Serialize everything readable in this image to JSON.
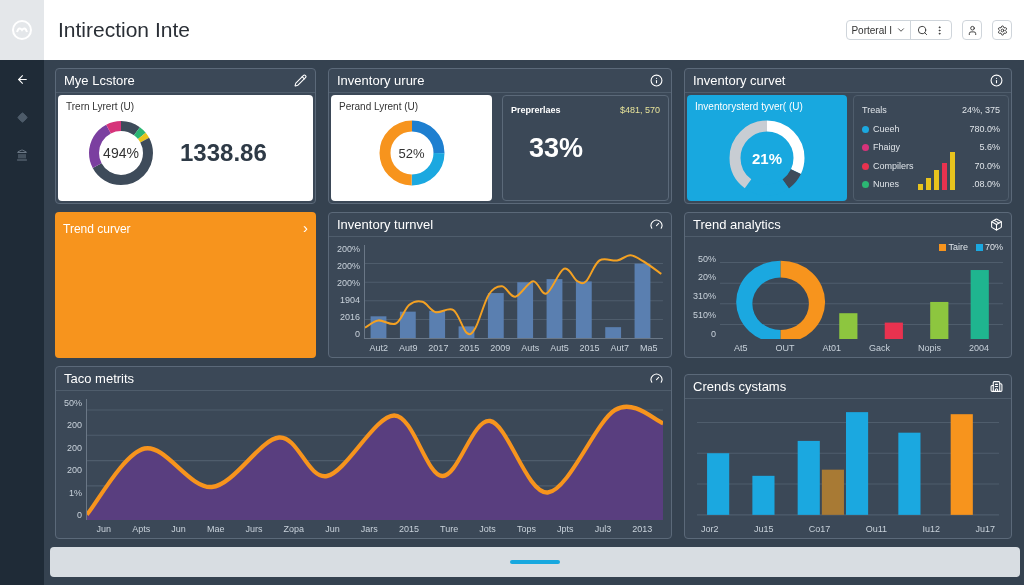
{
  "header": {
    "title": "Intirection Inte",
    "selector": {
      "value": "Porteral I"
    }
  },
  "store_panel": {
    "title": "Mye Lcstore",
    "card": {
      "label": "Trern Lyrert (U)",
      "donut_value": "494%",
      "big_value": "1338.86"
    }
  },
  "inventory_panel": {
    "title": "Inventory urure",
    "white_card": {
      "label": "Perand Lyrent (U)",
      "donut_value": "52%"
    },
    "dark_card": {
      "label": "Preprerlaes",
      "amount": "$481, 570",
      "big_value": "33%"
    }
  },
  "curve_panel": {
    "title": "Inventory curvet",
    "blue_card": {
      "label": "Inventorysterd tyver( (U)",
      "gauge_value": "21%"
    },
    "legend_header": {
      "label": "Treals",
      "value": "24%, 375"
    },
    "legend": [
      {
        "label": "Cueeh",
        "value": "780.0%",
        "color": "#1ba8e0"
      },
      {
        "label": "Fhaigy",
        "value": "5.6%",
        "color": "#d6337a"
      },
      {
        "label": "Compilers",
        "value": "70.0%",
        "color": "#e8324f"
      },
      {
        "label": "Nunes",
        "value": ".08.0%",
        "color": "#2bb673"
      }
    ]
  },
  "orange_panel": {
    "title": "Trend curver",
    "chevron": "›"
  },
  "turnover_panel": {
    "title": "Inventory turnvel",
    "y_labels": [
      "200%",
      "200%",
      "200%",
      "1904",
      "2016",
      "0"
    ],
    "x_labels": [
      "Aut2",
      "Aut9",
      "2017",
      "2015",
      "2009",
      "Auts",
      "Aut5",
      "2015",
      "Aut7",
      "Ma5"
    ]
  },
  "analytics_panel": {
    "title": "Trend analytics",
    "legend": [
      {
        "label": "Taire",
        "color": "#f7941d"
      },
      {
        "label": "70%",
        "color": "#1ba8e0"
      }
    ],
    "y_labels": [
      "50%",
      "20%",
      "310%",
      "510%",
      "0"
    ],
    "x_labels": [
      "At5",
      "OUT",
      "At01",
      "Gack",
      "Nopis",
      "2004"
    ]
  },
  "metrics_panel": {
    "title": "Taco metrits",
    "y_labels": [
      "50%",
      "200",
      "200",
      "200",
      "1%",
      "0"
    ],
    "x_labels": [
      "Jun",
      "Apts",
      "Jun",
      "Mae",
      "Jurs",
      "Zopa",
      "Jun",
      "Jars",
      "2015",
      "Ture",
      "Jots",
      "Tops",
      "Jpts",
      "Jul3",
      "2013"
    ]
  },
  "systems_panel": {
    "title": "Crends cystams",
    "x_labels": [
      "Jor2",
      "Ju15",
      "Co17",
      "Ou11",
      "Iu12",
      "Ju17"
    ]
  }
}
